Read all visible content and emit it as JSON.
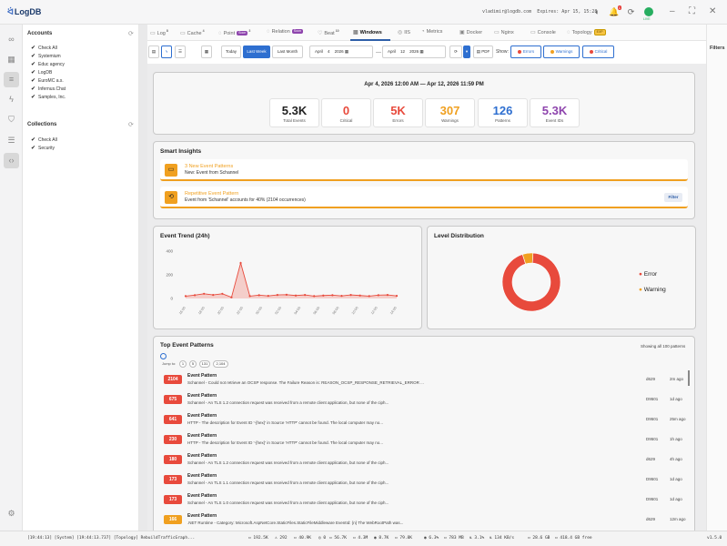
{
  "app": {
    "name": "LogDB"
  },
  "header": {
    "user_email": "vladimir@logdb.com",
    "expires": "Expires: Apr 15, 15:28",
    "notif_count": "1",
    "live_label": "LIVE"
  },
  "sidebar": {
    "accounts_title": "Accounts",
    "accounts": [
      "Check All",
      "Systemium",
      "Educ agency",
      "LogDB",
      "EuroMC a.s.",
      "Infernus.Chat",
      "Samples, Inc."
    ],
    "collections_title": "Collections",
    "collections": [
      "Check All",
      "Security"
    ]
  },
  "tabs": [
    {
      "label": "Log",
      "count": "8",
      "icon": "log-icon"
    },
    {
      "label": "Cache",
      "count": "4",
      "icon": "cache-icon"
    },
    {
      "label": "Point",
      "chip": "Soon",
      "count": "3",
      "icon": "point-icon"
    },
    {
      "label": "Relation",
      "chip": "Soon",
      "icon": "relation-icon"
    },
    {
      "label": "Beat",
      "count": "10",
      "icon": "beat-icon"
    },
    {
      "label": "Windows",
      "icon": "windows-icon",
      "active": true
    },
    {
      "label": "IIS",
      "icon": "iis-icon"
    },
    {
      "label": "Metrics",
      "icon": "metrics-icon"
    },
    {
      "label": "Docker",
      "icon": "docker-icon"
    },
    {
      "label": "Nginx",
      "icon": "nginx-icon"
    },
    {
      "label": "Console",
      "icon": "console-icon"
    },
    {
      "label": "Topology",
      "chip": "EXP",
      "icon": "topology-icon"
    }
  ],
  "filters_label": "Filters",
  "toolbar": {
    "today": "Today",
    "last_week": "Last Week",
    "last_month": "Last Month",
    "from_month": "April",
    "from_day": "4",
    "from_year": "2026",
    "to_month": "April",
    "to_day": "12",
    "to_year": "2026",
    "pdf": "PDF",
    "show": "Show:",
    "errors": "Errors",
    "warnings": "Warnings",
    "critical": "Critical",
    "colors": {
      "errors": "#e84a3c",
      "warnings": "#f0a020",
      "critical": "#e84a3c"
    }
  },
  "summary": {
    "range": "Apr 4, 2026 12:00 AM — Apr 12, 2026 11:59 PM",
    "stats": [
      {
        "value": "5.3K",
        "label": "Total Events",
        "color": "#222222"
      },
      {
        "value": "0",
        "label": "Critical",
        "color": "#e84a3c"
      },
      {
        "value": "5K",
        "label": "Errors",
        "color": "#e84a3c"
      },
      {
        "value": "307",
        "label": "Warnings",
        "color": "#f0a020"
      },
      {
        "value": "126",
        "label": "Patterns",
        "color": "#2e6fd0"
      },
      {
        "value": "5.3K",
        "label": "Event IDs",
        "color": "#8e44ad"
      }
    ]
  },
  "insights": {
    "title": "Smart Insights",
    "items": [
      {
        "title": "3 New Event Patterns",
        "desc": "New: Event  from Schannel",
        "icon": "new-patterns-icon"
      },
      {
        "title": "Repetitive Event Pattern",
        "desc": "Event  from 'Schannel' accounts for 40% (2104 occurrences)",
        "icon": "repeat-icon",
        "action": "Filter"
      }
    ]
  },
  "trend": {
    "title": "Event Trend (24h)"
  },
  "level": {
    "title": "Level Distribution",
    "legend": [
      {
        "label": "Error",
        "color": "#e84a3c"
      },
      {
        "label": "Warning",
        "color": "#f0a020"
      }
    ]
  },
  "chart_data": [
    {
      "type": "area",
      "title": "Event Trend (24h)",
      "ylim": [
        0,
        400
      ],
      "yticks": [
        "400",
        "200",
        "0"
      ],
      "x": [
        "16:00",
        "18:00",
        "20:00",
        "22:00",
        "00:00",
        "02:00",
        "04:00",
        "06:00",
        "08:00",
        "10:00",
        "12:00",
        "14:00"
      ],
      "values": [
        20,
        28,
        40,
        30,
        40,
        10,
        300,
        20,
        28,
        22,
        30,
        32,
        25,
        30,
        20,
        25,
        28,
        22,
        30,
        25,
        20,
        28,
        30,
        22
      ]
    },
    {
      "type": "pie",
      "title": "Level Distribution",
      "series": [
        {
          "name": "Error",
          "value": 5000,
          "color": "#e84a3c"
        },
        {
          "name": "Warning",
          "value": 307,
          "color": "#f0a020"
        }
      ]
    }
  ],
  "patterns": {
    "title": "Top Event Patterns",
    "showing": "Showing all 100 patterns",
    "jump_label": "Jump to:",
    "jump": [
      "1",
      "5",
      "131",
      "2,104"
    ],
    "rows": [
      {
        "count": "2104",
        "title": "Event Pattern",
        "msg": "Schannel - Could not retrieve an OCSP response. The Failure Reason is: REASON_OCSP_RESPONSE_RETRIEVAL_ERROR ...",
        "src": "d629",
        "ago": "2m ago",
        "warn": false
      },
      {
        "count": "675",
        "title": "Event Pattern",
        "msg": "Schannel - An TLS 1.2 connection request was received from a remote client application, but none of the ciph...",
        "src": "D9501",
        "ago": "1d ago",
        "warn": false
      },
      {
        "count": "641",
        "title": "Event Pattern",
        "msg": "HTTP - The description for Event ID '-{hex}' in Source 'HTTP' cannot be found. The local computer may no...",
        "src": "D9501",
        "ago": "25m ago",
        "warn": false
      },
      {
        "count": "230",
        "title": "Event Pattern",
        "msg": "HTTP - The description for Event ID '-{hex}' in Source 'HTTP' cannot be found. The local computer may no...",
        "src": "D9501",
        "ago": "1h ago",
        "warn": false
      },
      {
        "count": "180",
        "title": "Event Pattern",
        "msg": "Schannel - An TLS 1.2 connection request was received from a remote client application, but none of the ciph...",
        "src": "d629",
        "ago": "4h ago",
        "warn": false
      },
      {
        "count": "173",
        "title": "Event Pattern",
        "msg": "Schannel - An TLS 1.1 connection request was received from a remote client application, but none of the ciph...",
        "src": "D9501",
        "ago": "1d ago",
        "warn": false
      },
      {
        "count": "173",
        "title": "Event Pattern",
        "msg": "Schannel - An TLS 1.0 connection request was received from a remote client application, but none of the ciph...",
        "src": "D9501",
        "ago": "1d ago",
        "warn": false
      },
      {
        "count": "166",
        "title": "Event Pattern",
        "msg": ".NET Runtime - Category: Microsoft.AspNetCore.StaticFiles.StaticFileMiddleware EventId: {n} The WebRootPath was...",
        "src": "d629",
        "ago": "12m ago",
        "warn": true
      }
    ]
  },
  "statusbar": {
    "log": "[19:44:13] [System] [19:44:13.737] [Topology] RebuildTrafficGraph...",
    "m1": "192.5K",
    "m2": "292",
    "m3": "40.9K",
    "m4": "0",
    "m5": "56.7K",
    "m6": "4.3M",
    "m7": "8.7K",
    "m8": "79.8K",
    "cpu": "6.3%",
    "mem": "783 MB",
    "net1": "3.1%",
    "net2": "134 KB/s",
    "disk1": "28.6 GB",
    "disk2": "418.4 GB free",
    "version": "v1.5.0"
  }
}
